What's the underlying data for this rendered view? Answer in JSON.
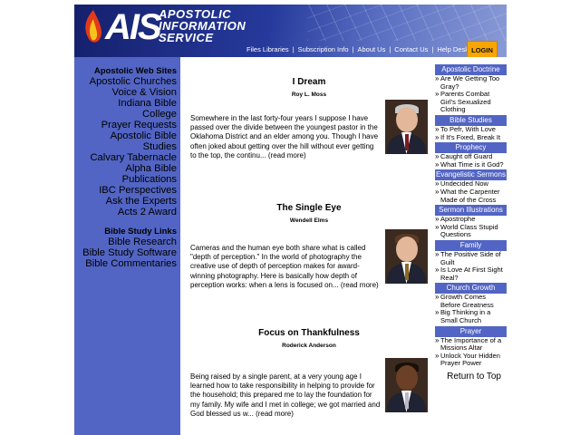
{
  "header": {
    "logo_abbrev": "AIS",
    "logo_lines": [
      "APOSTOLIC",
      "INFORMATION",
      "SERVICE"
    ],
    "nav": [
      "Files Libraries",
      "Subscription Info",
      "About Us",
      "Contact Us",
      "Help Desk"
    ],
    "nav_separator": "|",
    "login_label": "LOGIN"
  },
  "left_sidebar": {
    "web_sites_heading": "Apostolic Web Sites",
    "web_sites": [
      "Apostolic Churches",
      "Voice & Vision",
      "Indiana Bible",
      "College",
      "Prayer Requests",
      "Apostolic Bible",
      "Studies",
      "Calvary Tabernacle",
      "Alpha Bible",
      "Publications",
      "IBC Perspectives",
      "Ask the Experts",
      "Acts 2 Award"
    ],
    "bible_study_heading": "Bible Study Links",
    "bible_study": [
      "Bible Research",
      "Bible Study Software",
      "Bible Commentaries"
    ]
  },
  "articles": [
    {
      "title": "I Dream",
      "author": "Roy L. Moss",
      "body": "Somewhere in the last forty-four years I suppose I have passed over the divide between the youngest pastor in the Oklahoma District and an elder among you. Though I have often joked about getting over the hill without ever getting to the top, the continu...",
      "read_more": "(read more)"
    },
    {
      "title": "The Single Eye",
      "author": "Wendell Elms",
      "body": "Cameras and the human eye both share what is called \"depth of perception.\" In the world of photography the creative use of depth of perception makes for award-winning photography. Here is basically how depth of perception works: when a lens is focused on...",
      "read_more": "(read more)"
    },
    {
      "title": "Focus on Thankfulness",
      "author": "Roderick Anderson",
      "body": "Being raised by a single parent, at a very young age I learned how to take responsibility in helping to provide for the household; this prepared me to lay the foundation for my family. My wife and I met in college; we got married and God blessed us w...",
      "read_more": "(read more)"
    }
  ],
  "right_sidebar": {
    "bullet": "»",
    "categories": [
      {
        "name": "Apostolic Doctrine",
        "links": [
          "Are We Getting Too Gray?",
          "Parents Combat Girl's Sexualized Clothing"
        ]
      },
      {
        "name": "Bible Studies",
        "links": [
          "To Pefr, With Love",
          "If It's Fixed, Break It"
        ]
      },
      {
        "name": "Prophecy",
        "links": [
          "Caught off Guard",
          "What Time is it God?"
        ]
      },
      {
        "name": "Evangelistic Sermons",
        "links": [
          "Undecided Now",
          "What the Carpenter Made of the Cross"
        ]
      },
      {
        "name": "Sermon Illustrations",
        "links": [
          "Apostrophe",
          "World Class Stupid Questions"
        ]
      },
      {
        "name": "Family",
        "links": [
          "The Positive Side of Guilt",
          "Is Love At First Sight Real?"
        ]
      },
      {
        "name": "Church Growth",
        "links": [
          "Growth Comes Before Greatness",
          "Big Thinking in a Small Church"
        ]
      },
      {
        "name": "Prayer",
        "links": [
          "The Importance of a Missions Altar",
          "Unlock Your Hidden Prayer Power"
        ]
      }
    ],
    "return_to_top": "Return to Top"
  },
  "colors": {
    "sidebar_blue": "#5265c4",
    "header_dark": "#15206c",
    "login_orange": "#f7a500"
  }
}
